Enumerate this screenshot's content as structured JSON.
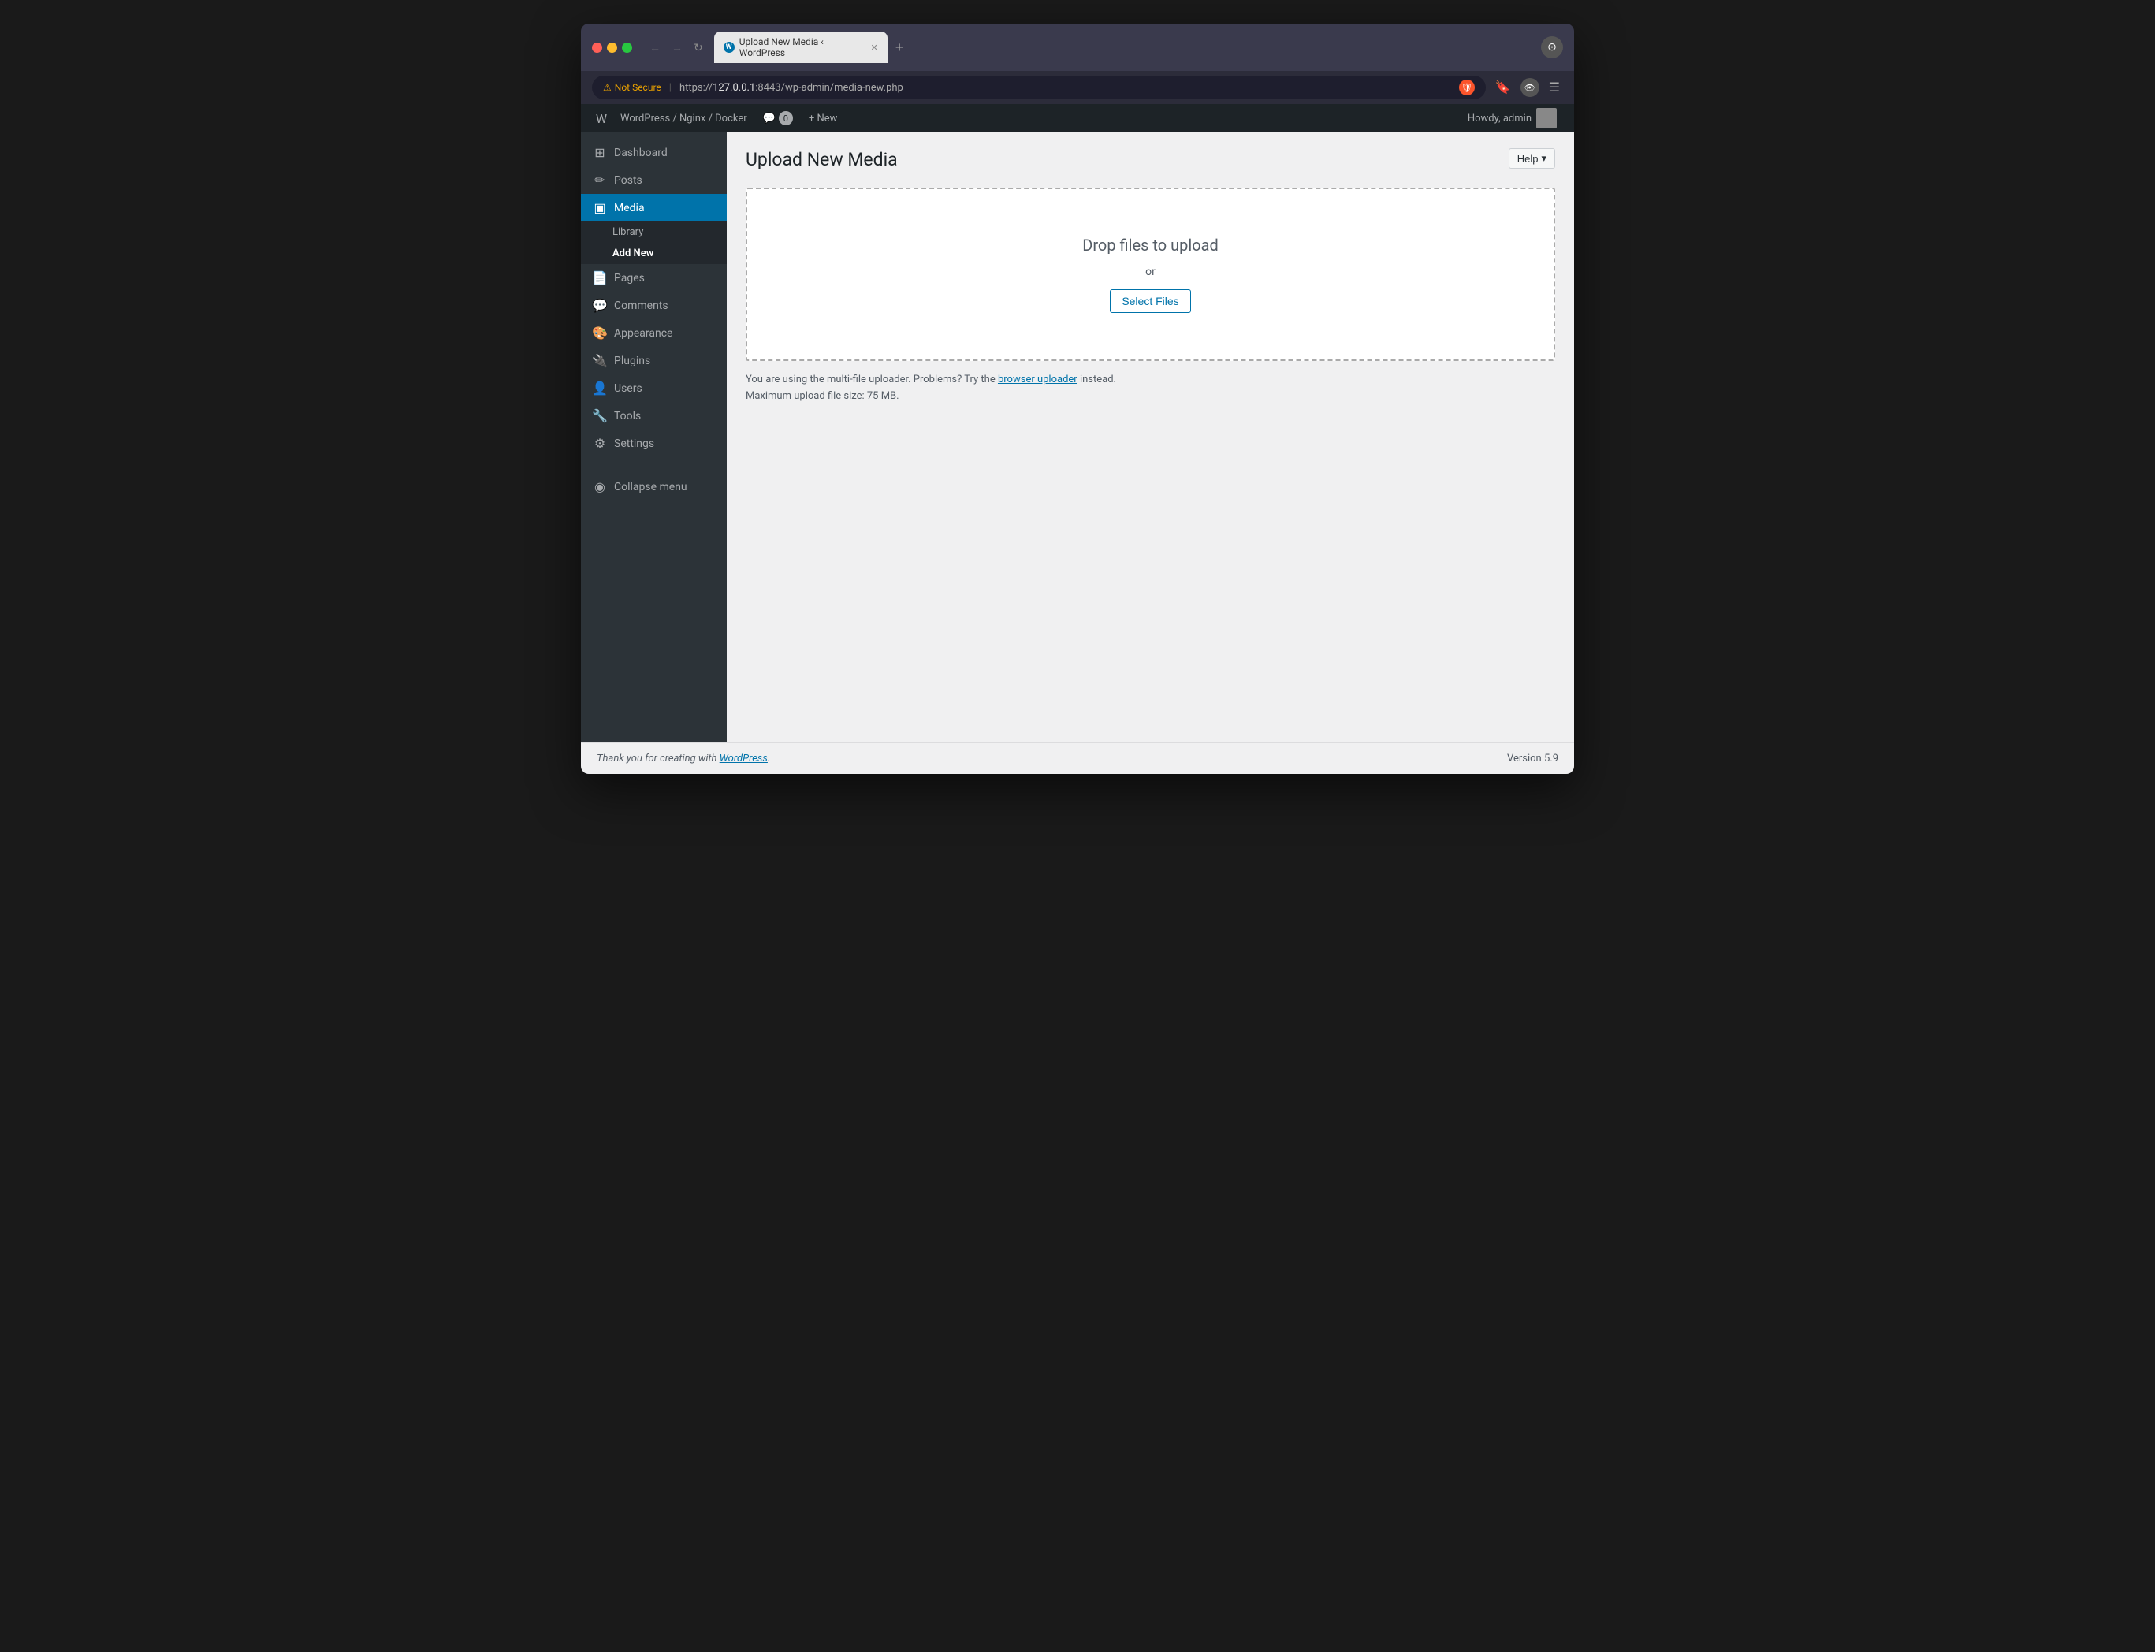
{
  "browser": {
    "tab_title": "Upload New Media ‹ WordPress",
    "tab_favicon": "W",
    "new_tab_label": "+",
    "address_bar": {
      "security_label": "Not Secure",
      "url_scheme": "https://",
      "url_host": "127.0.0.1",
      "url_port": ":8443",
      "url_path": "/wp-admin/media-new.php"
    },
    "nav": {
      "back": "←",
      "forward": "→",
      "reload": "↻"
    }
  },
  "adminbar": {
    "site_name": "WordPress / Nginx / Docker",
    "comments_count": "0",
    "new_label": "+ New",
    "howdy_label": "Howdy, admin"
  },
  "sidebar": {
    "items": [
      {
        "id": "dashboard",
        "label": "Dashboard",
        "icon": "⊞"
      },
      {
        "id": "posts",
        "label": "Posts",
        "icon": "✏"
      },
      {
        "id": "media",
        "label": "Media",
        "icon": "🖼",
        "active": true
      },
      {
        "id": "pages",
        "label": "Pages",
        "icon": "📄"
      },
      {
        "id": "comments",
        "label": "Comments",
        "icon": "💬"
      },
      {
        "id": "appearance",
        "label": "Appearance",
        "icon": "🎨"
      },
      {
        "id": "plugins",
        "label": "Plugins",
        "icon": "🔌"
      },
      {
        "id": "users",
        "label": "Users",
        "icon": "👤"
      },
      {
        "id": "tools",
        "label": "Tools",
        "icon": "🔧"
      },
      {
        "id": "settings",
        "label": "Settings",
        "icon": "⚙"
      }
    ],
    "media_submenu": {
      "library_label": "Library",
      "add_new_label": "Add New"
    },
    "collapse_label": "Collapse menu",
    "collapse_icon": "◉"
  },
  "content": {
    "page_title": "Upload New Media",
    "help_btn_label": "Help",
    "help_btn_arrow": "▾",
    "dropzone": {
      "drop_text": "Drop files to upload",
      "or_text": "or",
      "select_files_label": "Select Files"
    },
    "info_text_prefix": "You are using the multi-file uploader. Problems? Try the ",
    "browser_uploader_link": "browser uploader",
    "info_text_suffix": " instead.",
    "max_upload_label": "Maximum upload file size: 75 MB."
  },
  "footer": {
    "thank_you_prefix": "Thank you for creating with ",
    "wordpress_link": "WordPress",
    "thank_you_suffix": ".",
    "version_label": "Version 5.9"
  },
  "colors": {
    "wp_blue": "#0073aa",
    "sidebar_bg": "#2c3338",
    "adminbar_bg": "#1d2327",
    "active_menu": "#0073aa",
    "content_bg": "#f0f0f1"
  }
}
